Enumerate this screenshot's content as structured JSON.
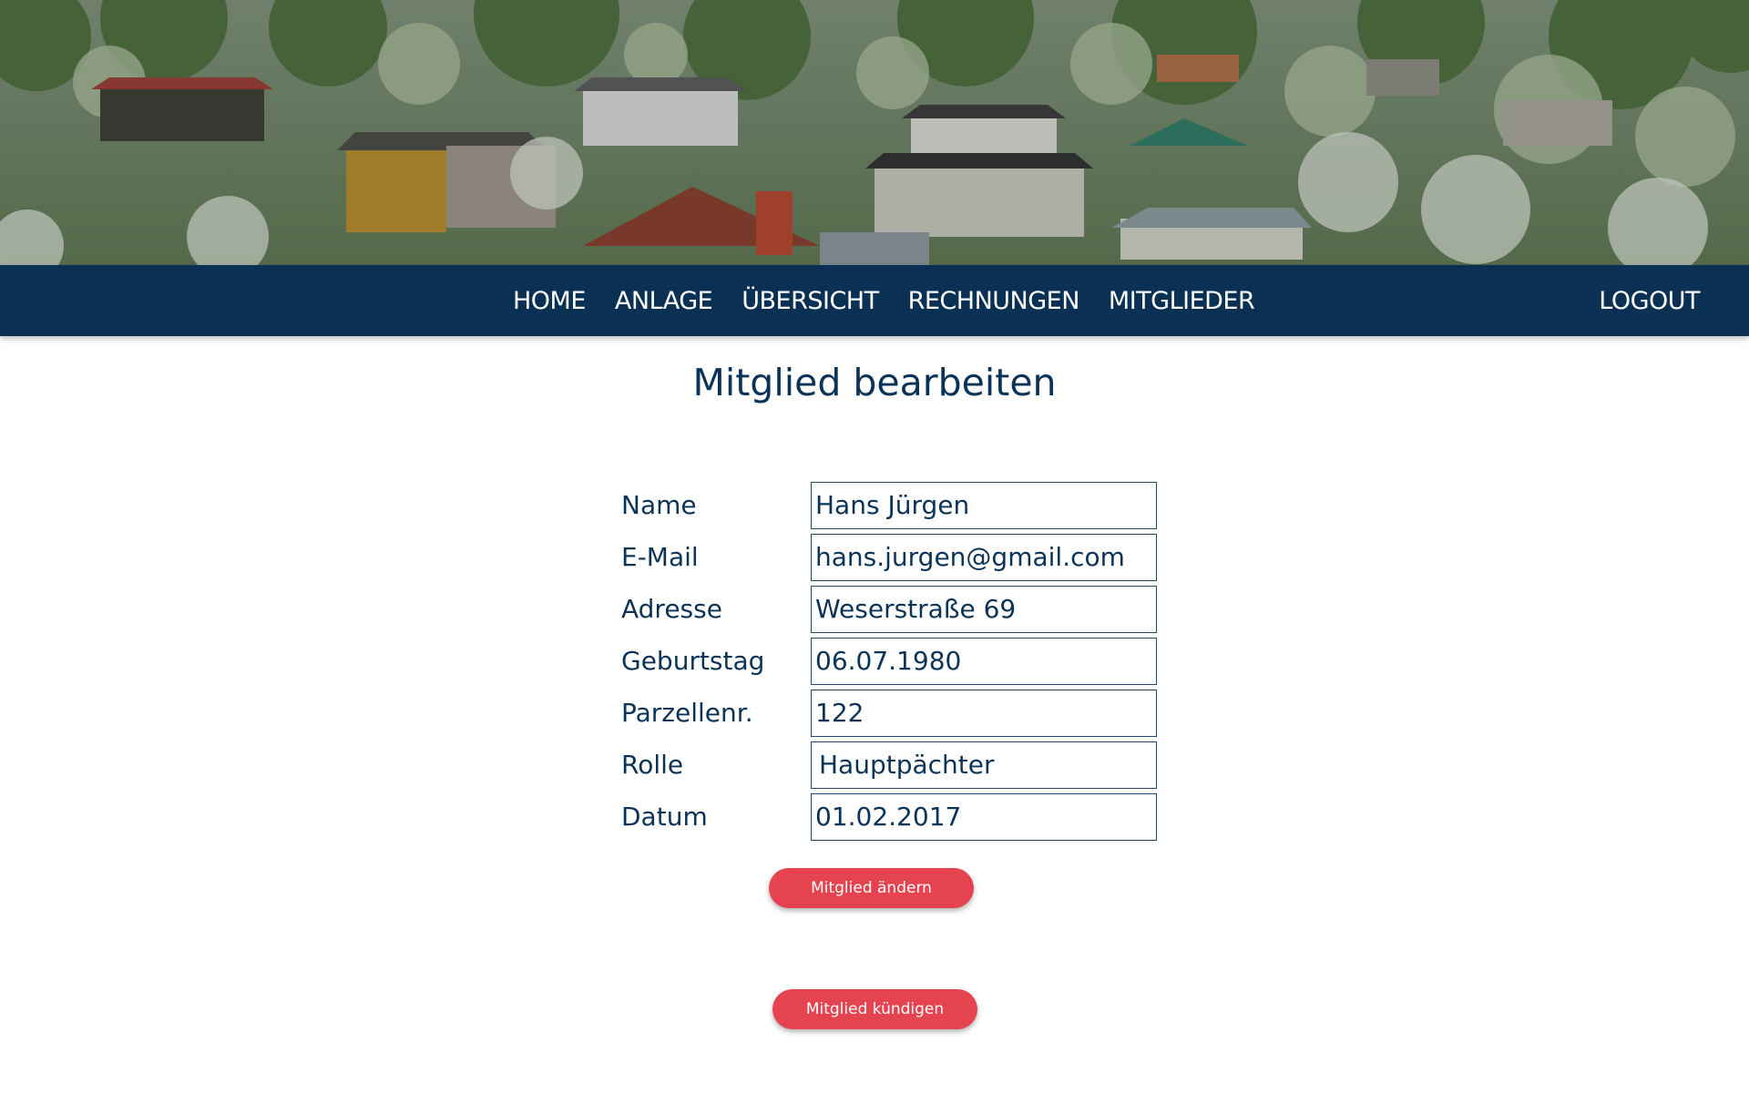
{
  "nav": {
    "items": [
      {
        "label": "HOME"
      },
      {
        "label": "ANLAGE"
      },
      {
        "label": "ÜBERSICHT"
      },
      {
        "label": "RECHNUNGEN"
      },
      {
        "label": "MITGLIEDER"
      }
    ],
    "logout_label": "LOGOUT"
  },
  "page": {
    "title": "Mitglied bearbeiten"
  },
  "form": {
    "fields": [
      {
        "label": "Name",
        "value": "Hans Jürgen"
      },
      {
        "label": "E-Mail",
        "value": "hans.jurgen@gmail.com"
      },
      {
        "label": "Adresse",
        "value": "Weserstraße 69"
      },
      {
        "label": "Geburtstag",
        "value": "06.07.1980"
      },
      {
        "label": "Parzellenr.",
        "value": "122"
      },
      {
        "label": "Rolle",
        "value": "Hauptpächter"
      },
      {
        "label": "Datum",
        "value": "01.02.2017"
      }
    ],
    "change_button": "Mitglied ändern",
    "cancel_button": "Mitglied kündigen"
  },
  "colors": {
    "navbar": "#0a3053",
    "text": "#0b3358",
    "button": "#e5434f"
  }
}
